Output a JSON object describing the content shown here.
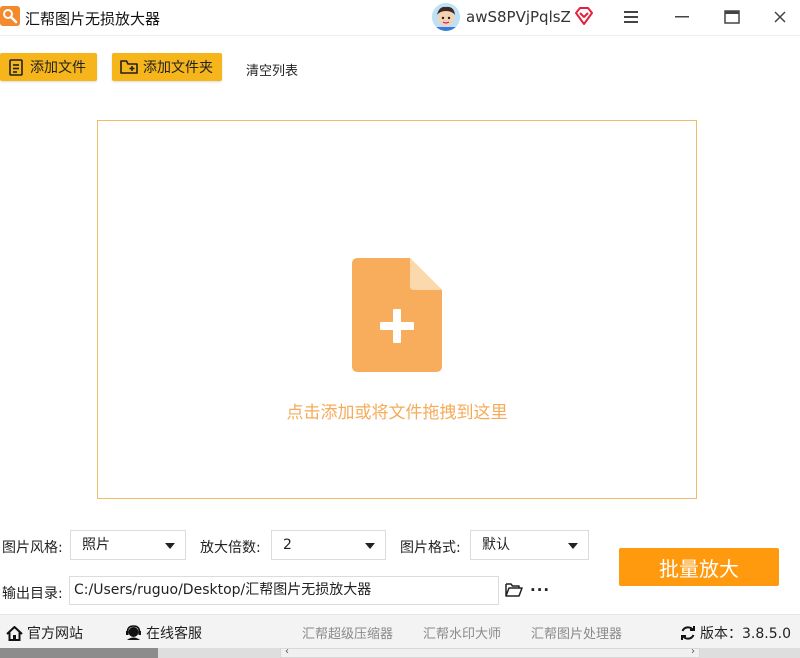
{
  "app": {
    "title": "汇帮图片无损放大器",
    "username": "awS8PVjPqlsZ"
  },
  "toolbar": {
    "add_file": "添加文件",
    "add_folder": "添加文件夹",
    "clear_list": "清空列表"
  },
  "dropzone": {
    "text": "点击添加或将文件拖拽到这里"
  },
  "settings": {
    "style_label": "图片风格:",
    "style_value": "照片",
    "scale_label": "放大倍数:",
    "scale_value": "2",
    "format_label": "图片格式:",
    "format_value": "默认",
    "output_label": "输出目录:",
    "output_path": "C:/Users/ruguo/Desktop/汇帮图片无损放大器",
    "more": "···",
    "batch_button": "批量放大"
  },
  "footer": {
    "official_site": "官方网站",
    "online_service": "在线客服",
    "link1": "汇帮超级压缩器",
    "link2": "汇帮水印大师",
    "link3": "汇帮图片处理器",
    "version_label": "版本：3.8.5.0"
  },
  "colors": {
    "accent_yellow": "#f5b51b",
    "batch_orange": "#ff9a0e",
    "drop_icon": "#f8ad5d",
    "drop_border": "#f0bc6a"
  }
}
